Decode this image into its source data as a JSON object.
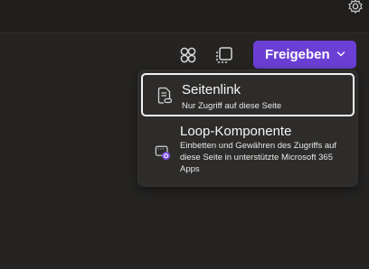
{
  "toolbar": {
    "share_label": "Freigeben",
    "icons": [
      "settings-icon",
      "apps-icon",
      "copy-icon",
      "chevron-down-icon"
    ]
  },
  "menu": {
    "items": [
      {
        "title": "Seitenlink",
        "description": "Nur Zugriff auf diese Seite",
        "icon": "page-link-icon"
      },
      {
        "title": "Loop-Komponente",
        "description": "Einbetten und Gewähren des Zugriffs auf diese Seite in unterstützte Microsoft 365 Apps",
        "icon": "loop-component-icon"
      }
    ]
  },
  "colors": {
    "accent": "#6b3fd4",
    "background": "#252423",
    "menu_background": "#2d2c2b"
  }
}
